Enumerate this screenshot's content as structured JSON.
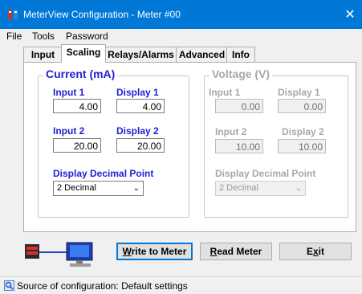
{
  "window": {
    "title": "MeterView Configuration - Meter #00",
    "close_glyph": "✕"
  },
  "menu": [
    "File",
    "Tools",
    "Password"
  ],
  "tabs": [
    "Input",
    "Scaling",
    "Relays/Alarms",
    "Advanced",
    "Info"
  ],
  "active_tab": "Scaling",
  "current_group": {
    "legend": "Current (mA)",
    "input1_label": "Input 1",
    "display1_label": "Display 1",
    "input1_value": "4.00",
    "display1_value": "4.00",
    "input2_label": "Input 2",
    "display2_label": "Display 2",
    "input2_value": "20.00",
    "display2_value": "20.00",
    "ddp_label": "Display Decimal Point",
    "ddp_value": "2 Decimal"
  },
  "voltage_group": {
    "legend": "Voltage (V)",
    "input1_label": "Input 1",
    "display1_label": "Display 1",
    "input1_value": "0.00",
    "display1_value": "0.00",
    "input2_label": "Input 2",
    "display2_label": "Display 2",
    "input2_value": "10.00",
    "display2_value": "10.00",
    "ddp_label": "Display Decimal Point",
    "ddp_value": "2 Decimal"
  },
  "buttons": {
    "write_prefix": "W",
    "write_rest": "rite to Meter",
    "read_prefix": "R",
    "read_rest": "ead Meter",
    "exit_prefix": "E",
    "exit_mid": "x",
    "exit_rest": "it"
  },
  "status": {
    "text": "Source of configuration: Default settings"
  },
  "colors": {
    "titlebar": "#0078d7",
    "label_blue": "#1f1fd6",
    "disabled": "#a8a8a8"
  },
  "icons": [
    "app-icon",
    "close-icon",
    "meter-icon",
    "computer-icon",
    "status-icon",
    "chevron-down-icon"
  ]
}
